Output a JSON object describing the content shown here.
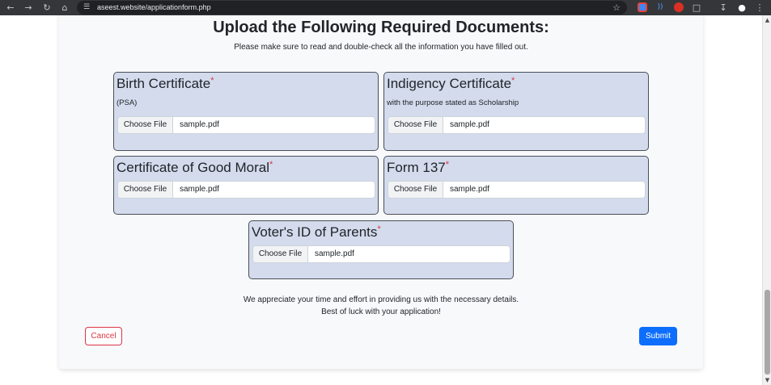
{
  "browser": {
    "url": "aseest.website/applicationform.php",
    "icons": [
      "back-icon",
      "forward-icon",
      "reload-icon",
      "home-icon",
      "site-settings-icon",
      "star-icon",
      "download-icon",
      "profile-icon",
      "menu-icon"
    ]
  },
  "form": {
    "heading": "Upload the Following Required Documents:",
    "subheading": "Please make sure to read and double-check all the information you have filled out.",
    "required_marker": "*",
    "documents": [
      {
        "title": "Birth Certificate",
        "note": "(PSA)",
        "button": "Choose File",
        "file": "sample.pdf"
      },
      {
        "title": "Indigency Certificate",
        "note": "with the purpose stated as Scholarship",
        "button": "Choose File",
        "file": "sample.pdf"
      },
      {
        "title": "Certificate of Good Moral",
        "note": "",
        "button": "Choose File",
        "file": "sample.pdf"
      },
      {
        "title": "Form 137",
        "note": "",
        "button": "Choose File",
        "file": "sample.pdf"
      },
      {
        "title": "Voter's ID of Parents",
        "note": "",
        "button": "Choose File",
        "file": "sample.pdf"
      }
    ],
    "thanks_line1": "We appreciate your time and effort in providing us with the necessary details.",
    "thanks_line2": "Best of luck with your application!",
    "cancel_label": "Cancel",
    "submit_label": "Submit"
  },
  "colors": {
    "box_bg": "#d3dbed",
    "required": "#dc3545",
    "submit": "#0d6efd",
    "chrome": "#35363a"
  }
}
